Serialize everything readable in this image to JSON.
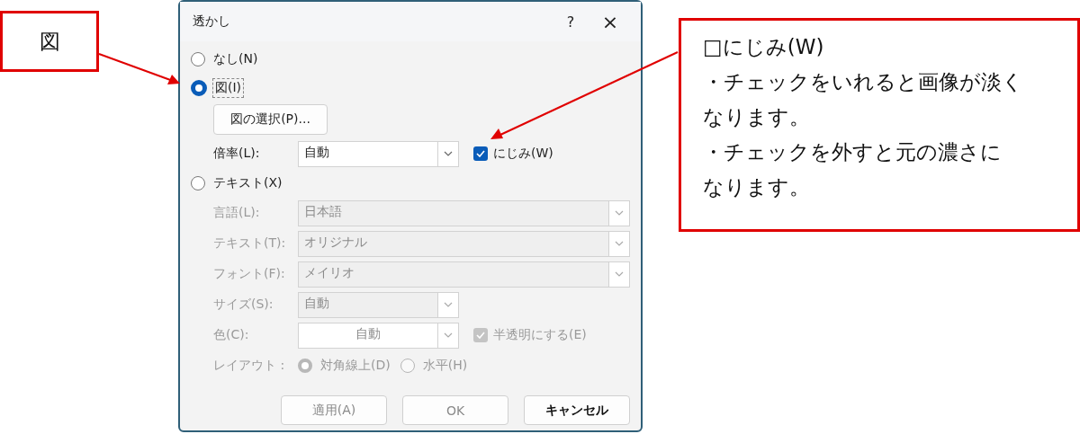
{
  "callouts": [
    {
      "lines": [
        "図"
      ]
    },
    {
      "lines": [
        "□にじみ(W)",
        "・チェックをいれると画像が淡く",
        "なります。",
        "・チェックを外すと元の濃さに",
        "なります。"
      ]
    }
  ],
  "dialog": {
    "title": "透かし",
    "help": "?",
    "close": "×"
  },
  "watermark_type": [
    {
      "label": "なし(N)",
      "selected": false
    },
    {
      "label": "図(I)",
      "selected": true
    },
    {
      "label": "テキスト(X)",
      "selected": false
    }
  ],
  "picture": {
    "select_button": "図の選択(P)...",
    "scale_label": "倍率(L):",
    "scale_value": "自動",
    "washout": {
      "label": "にじみ(W)",
      "checked": true
    }
  },
  "text_fields": [
    {
      "label": "言語(L):",
      "value": "日本語",
      "kind": "wide",
      "disabled": true
    },
    {
      "label": "テキスト(T):",
      "value": "オリジナル",
      "kind": "wide",
      "disabled": true
    },
    {
      "label": "フォント(F):",
      "value": "メイリオ",
      "kind": "wide",
      "disabled": true
    },
    {
      "label": "サイズ(S):",
      "value": "自動",
      "kind": "short",
      "disabled": true
    },
    {
      "label": "色(C):",
      "value": "自動",
      "kind": "color",
      "disabled": true
    }
  ],
  "semitransparent": {
    "label": "半透明にする(E)",
    "checked": true,
    "disabled": true
  },
  "layout": {
    "label": "レイアウト :",
    "disabled": true,
    "options": [
      {
        "label": "対角線上(D)",
        "selected": true
      },
      {
        "label": "水平(H)",
        "selected": false
      }
    ]
  },
  "buttons": [
    {
      "label": "適用(A)",
      "disabled": true
    },
    {
      "label": "OK",
      "disabled": true
    },
    {
      "label": "キャンセル",
      "disabled": false
    }
  ]
}
